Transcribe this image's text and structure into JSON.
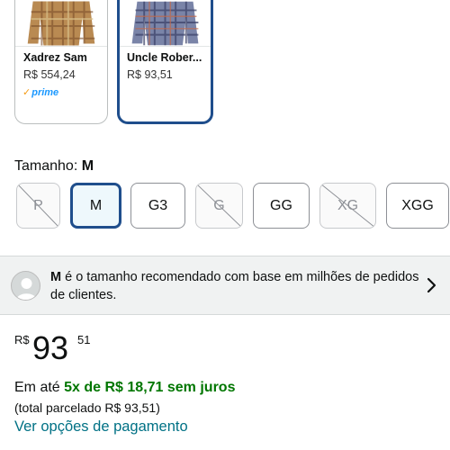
{
  "variants": [
    {
      "name": "Xadrez Sam",
      "price": "R$ 554,24",
      "badge": "prime",
      "selected": false
    },
    {
      "name": "Uncle Rober...",
      "price": "R$ 93,51",
      "badge": "",
      "selected": true
    }
  ],
  "size": {
    "label": "Tamanho:",
    "selected": "M",
    "options": [
      {
        "label": "P",
        "available": false
      },
      {
        "label": "M",
        "available": true,
        "selected": true
      },
      {
        "label": "G3",
        "available": true
      },
      {
        "label": "G",
        "available": false
      },
      {
        "label": "GG",
        "available": true
      },
      {
        "label": "XG",
        "available": false
      },
      {
        "label": "XGG",
        "available": true
      }
    ]
  },
  "recommendation": {
    "size": "M",
    "text": " é o tamanho recomendado com base em milhões de pedidos de clientes."
  },
  "price": {
    "currency": "R$",
    "whole": "93",
    "cents": "51"
  },
  "installments": {
    "prefix": "Em até ",
    "highlight": "5x de R$ 18,71 sem juros",
    "total": "(total parcelado R$ 93,51)"
  },
  "payment_link": "Ver opções de pagamento",
  "colors": {
    "accent_blue": "#1f4e8c",
    "green": "#007600",
    "link": "#007185",
    "prime_blue": "#1a98ff"
  }
}
